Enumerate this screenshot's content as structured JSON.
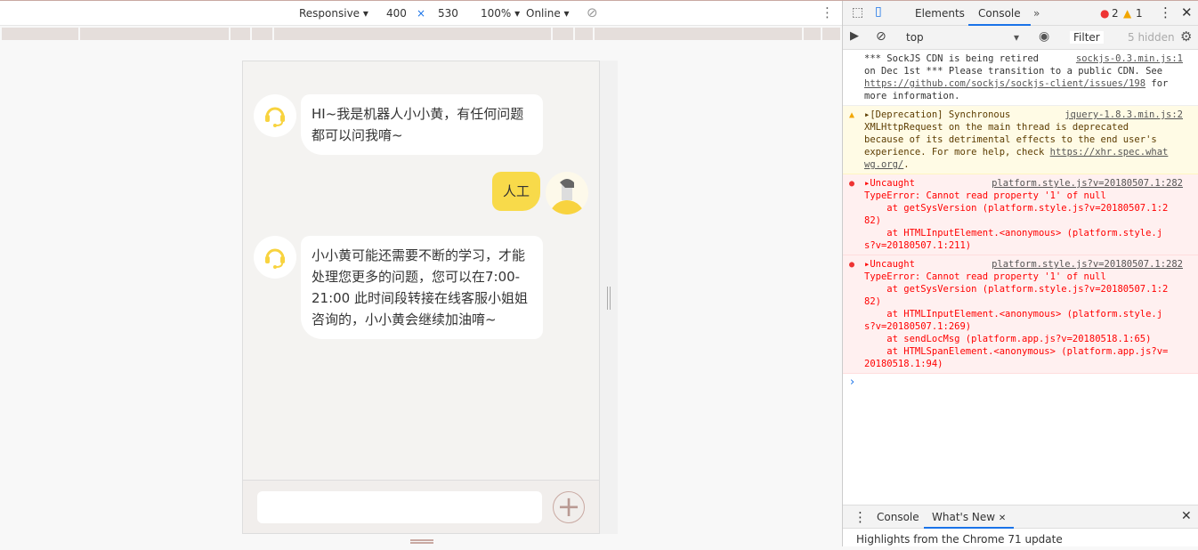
{
  "device_toolbar": {
    "device": "Responsive",
    "width": "400",
    "times": "×",
    "height": "530",
    "zoom": "100%",
    "network": "Online"
  },
  "chat": {
    "messages": [
      {
        "from": "bot",
        "text": "HI~我是机器人小小黄，有任何问题都可以问我唷~"
      },
      {
        "from": "user",
        "text": "人工"
      },
      {
        "from": "bot",
        "text": "小小黄可能还需要不断的学习，才能处理您更多的问题，您可以在7:00-21:00 此时间段转接在线客服小姐姐咨询的，小小黄会继续加油唷~"
      }
    ],
    "input_placeholder": "",
    "plus_label": "+"
  },
  "devtools": {
    "tabs": [
      "Elements",
      "Console"
    ],
    "more": "»",
    "error_count": "2",
    "warning_count": "1",
    "context": "top",
    "filter": "Filter",
    "hidden": "5 hidden",
    "messages": [
      {
        "level": "info",
        "text": "*** SockJS CDN is being retired\non Dec 1st *** Please transition to a public CDN. See\n",
        "link": "https://github.com/sockjs/sockjs-client/issues/198",
        "tail": " for\nmore information.",
        "source": "sockjs-0.3.min.js:1"
      },
      {
        "level": "warning",
        "text": "▸[Deprecation] Synchronous\nXMLHttpRequest on the main thread is deprecated\nbecause of its detrimental effects to the end user's\nexperience. For more help, check ",
        "link": "https://xhr.spec.what\nwg.org/",
        "tail": ".",
        "source": "jquery-1.8.3.min.js:2"
      },
      {
        "level": "error",
        "text": "▸Uncaught\nTypeError: Cannot read property '1' of null\n    at getSysVersion (platform.style.js?v=20180507.1:2\n82)\n    at HTMLInputElement.<anonymous> (platform.style.j\ns?v=20180507.1:211)",
        "source": "platform.style.js?v=20180507.1:282"
      },
      {
        "level": "error",
        "text": "▸Uncaught\nTypeError: Cannot read property '1' of null\n    at getSysVersion (platform.style.js?v=20180507.1:2\n82)\n    at HTMLInputElement.<anonymous> (platform.style.j\ns?v=20180507.1:269)\n    at sendLocMsg (platform.app.js?v=20180518.1:65)\n    at HTMLSpanElement.<anonymous> (platform.app.js?v=\n20180518.1:94)",
        "source": "platform.style.js?v=20180507.1:282"
      }
    ],
    "prompt": "›",
    "drawer": {
      "tabs": [
        "Console",
        "What's New"
      ],
      "content": "Highlights from the Chrome 71 update"
    }
  }
}
